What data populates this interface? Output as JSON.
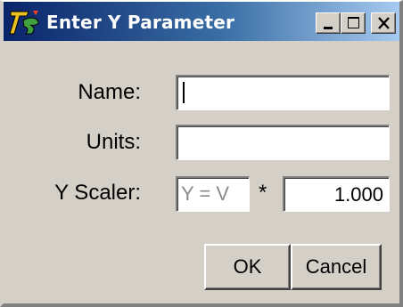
{
  "window": {
    "title": "Enter Y Parameter",
    "app_icon": "app-logo-icon",
    "controls": {
      "minimize_icon": "minimize-icon",
      "maximize_icon": "maximize-icon",
      "close_icon": "close-icon"
    },
    "title_gradient": [
      "#0a246a",
      "#a6caf0"
    ],
    "face_color": "#d4d0c8"
  },
  "form": {
    "name_label": "Name:",
    "name_value": "",
    "units_label": "Units:",
    "units_value": "",
    "scaler_label": "Y Scaler:",
    "y_expression": "Y = V",
    "multiply_symbol": "*",
    "scaler_value": "1.000"
  },
  "buttons": {
    "ok": "OK",
    "cancel": "Cancel"
  }
}
